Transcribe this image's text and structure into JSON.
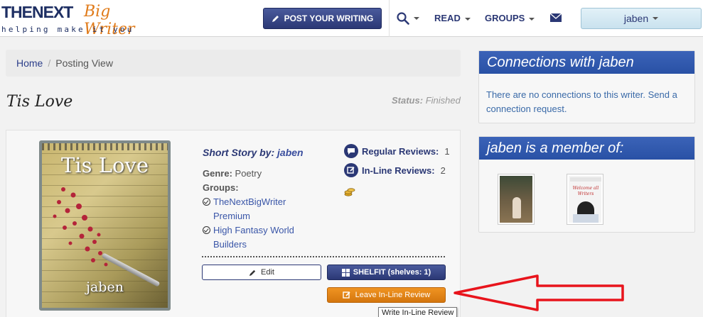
{
  "header": {
    "logo_line1": "THENEXT",
    "logo_line1_script": "Big Writer",
    "logo_tagline": "helping make it you",
    "post_button": "POST YOUR WRITING",
    "nav_read": "READ",
    "nav_groups": "GROUPS",
    "user_menu": "jaben"
  },
  "breadcrumb": {
    "home": "Home",
    "current": "Posting View"
  },
  "story": {
    "title": "Tis Love",
    "status_label": "Status:",
    "status_value": "Finished",
    "cover_title": "Tis Love",
    "cover_author": "jaben",
    "byline_prefix": "Short Story by:",
    "author": "jaben",
    "genre_label": "Genre:",
    "genre": "Poetry",
    "groups_label": "Groups:",
    "groups": [
      "TheNextBigWriter Premium",
      "High Fantasy World Builders"
    ],
    "group1_line1": "TheNextBigWriter",
    "group1_line2": "Premium",
    "group2_line1": "High Fantasy World",
    "group2_line2": "Builders",
    "regular_reviews_label": "Regular Reviews:",
    "regular_reviews_count": "1",
    "inline_reviews_label": "In-Line Reviews:",
    "inline_reviews_count": "2"
  },
  "actions": {
    "edit": "Edit",
    "shelfit": "SHELFIT (shelves: 1)",
    "leave_inline": "Leave In-Line Review",
    "tooltip": "Write In-Line Review"
  },
  "sidebar": {
    "connections_title": "Connections with jaben",
    "connections_text": "There are no connections to this writer. Send a connection request.",
    "member_title": "jaben is a member of:",
    "thumb2_line1": "Welcome all",
    "thumb2_line2": "Writers"
  },
  "colors": {
    "brand_navy": "#2b3875",
    "panel_blue": "#2951a5",
    "orange": "#e0851a",
    "arrow_red": "#e8141c"
  }
}
